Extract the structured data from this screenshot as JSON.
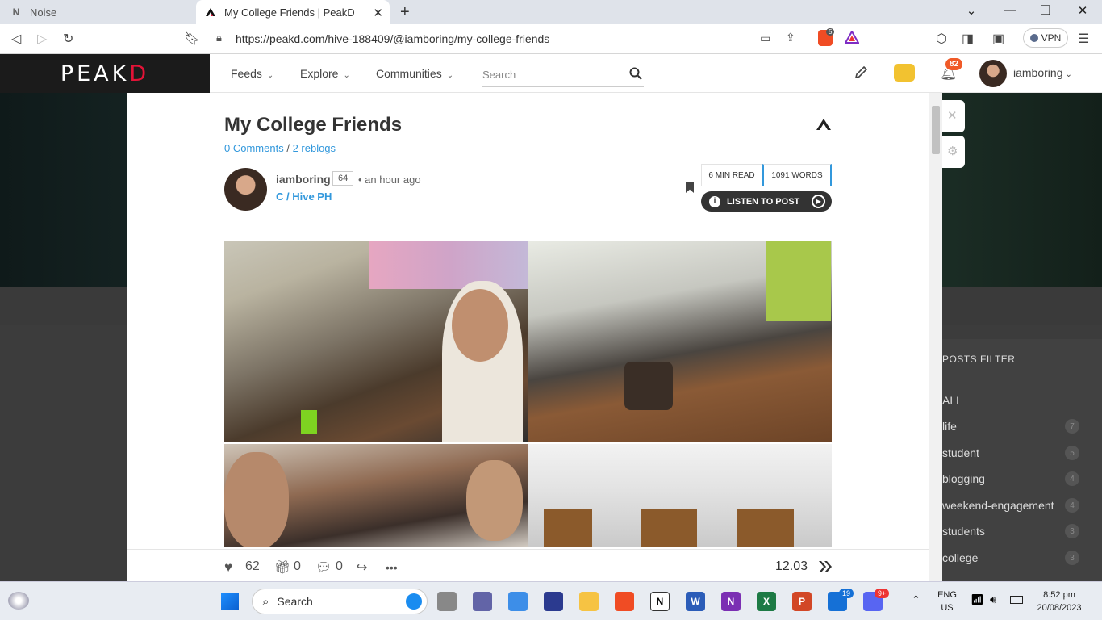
{
  "browser": {
    "tabs": [
      {
        "title": "Noise",
        "icon": "notion-icon"
      },
      {
        "title": "My College Friends | PeakD",
        "icon": "peakd-icon"
      }
    ],
    "url": "https://peakd.com/hive-188409/@iamboring/my-college-friends",
    "brave_badge": "5",
    "vpn_label": "VPN"
  },
  "site": {
    "logo_left": "PE",
    "logo_a": "A",
    "logo_k": "K",
    "logo_d": "D",
    "nav": [
      "Feeds",
      "Explore",
      "Communities"
    ],
    "search_placeholder": "Search",
    "notifications": "82",
    "username": "iamboring"
  },
  "post": {
    "title": "My College Friends",
    "comments": "0 Comments",
    "reblogs": "2 reblogs",
    "author": "iamboring",
    "reputation": "64",
    "time": "• an hour ago",
    "community": "C / Hive PH",
    "read_time": "6 MIN READ",
    "words": "1091 WORDS",
    "listen_label": "LISTEN TO POST",
    "likes": "62",
    "gifts": "0",
    "comment_count": "0",
    "payout": "12.03",
    "more": "•••"
  },
  "sidebar": {
    "title": "POSTS FILTER",
    "items": [
      {
        "label": "ALL",
        "count": ""
      },
      {
        "label": "life",
        "count": "7"
      },
      {
        "label": "student",
        "count": "5"
      },
      {
        "label": "blogging",
        "count": "4"
      },
      {
        "label": "weekend-engagement",
        "count": "4"
      },
      {
        "label": "students",
        "count": "3"
      },
      {
        "label": "college",
        "count": "3"
      }
    ]
  },
  "taskbar": {
    "search_label": "Search",
    "teams_badge": "19",
    "discord_badge": "9+",
    "lang_top": "ENG",
    "lang_bottom": "US",
    "time": "8:52 pm",
    "date": "20/08/2023"
  }
}
